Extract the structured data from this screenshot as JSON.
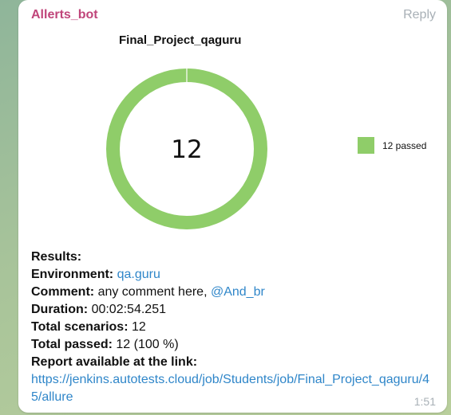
{
  "message": {
    "sender": "Allerts_bot",
    "reply_label": "Reply",
    "time": "1:51"
  },
  "chart_data": {
    "type": "pie",
    "title": "Final_Project_qaguru",
    "center_label": "12",
    "slices": [
      {
        "label": "12 passed",
        "value": 12,
        "color": "#8fcd69"
      }
    ],
    "legend_position": "right"
  },
  "results": {
    "heading": "Results:",
    "environment_label": "Environment:",
    "environment_value": "qa.guru",
    "comment_label": "Comment:",
    "comment_text": "any comment here,",
    "comment_mention": "@And_br",
    "duration_label": "Duration:",
    "duration_value": "00:02:54.251",
    "total_scenarios_label": "Total scenarios:",
    "total_scenarios_value": "12",
    "total_passed_label": "Total passed:",
    "total_passed_value": "12 (100 %)",
    "report_label": "Report available at the link:",
    "report_link": "https://jenkins.autotests.cloud/job/Students/job/Final_Project_qaguru/45/allure"
  }
}
